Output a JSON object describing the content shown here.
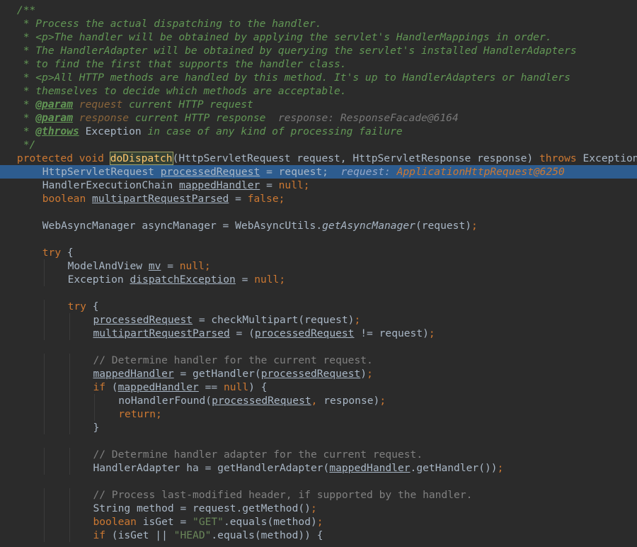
{
  "editor": {
    "lines": [
      {
        "indent": 2,
        "current": false,
        "tokens": [
          {
            "t": "/**",
            "c": "doc"
          }
        ]
      },
      {
        "indent": 2,
        "current": false,
        "tokens": [
          {
            "t": " * Process the actual dispatching to the handler.",
            "c": "doc"
          }
        ]
      },
      {
        "indent": 2,
        "current": false,
        "tokens": [
          {
            "t": " * <p>The handler will be obtained by applying the servlet's HandlerMappings in order.",
            "c": "doc"
          }
        ]
      },
      {
        "indent": 2,
        "current": false,
        "tokens": [
          {
            "t": " * The HandlerAdapter will be obtained by querying the servlet's installed HandlerAdapters",
            "c": "doc"
          }
        ]
      },
      {
        "indent": 2,
        "current": false,
        "tokens": [
          {
            "t": " * to find the first that supports the handler class.",
            "c": "doc"
          }
        ]
      },
      {
        "indent": 2,
        "current": false,
        "tokens": [
          {
            "t": " * <p>All HTTP methods are handled by this method. It's up to HandlerAdapters or handlers",
            "c": "doc"
          }
        ]
      },
      {
        "indent": 2,
        "current": false,
        "tokens": [
          {
            "t": " * themselves to decide which methods are acceptable.",
            "c": "doc"
          }
        ]
      },
      {
        "indent": 2,
        "current": false,
        "tokens": [
          {
            "t": " * ",
            "c": "doc"
          },
          {
            "t": "@param",
            "c": "doctag"
          },
          {
            "t": " ",
            "c": "doc"
          },
          {
            "t": "request",
            "c": "docparam"
          },
          {
            "t": " current HTTP request",
            "c": "doc"
          }
        ]
      },
      {
        "indent": 2,
        "current": false,
        "tokens": [
          {
            "t": " * ",
            "c": "doc"
          },
          {
            "t": "@param",
            "c": "doctag"
          },
          {
            "t": " ",
            "c": "doc"
          },
          {
            "t": "response",
            "c": "docparam"
          },
          {
            "t": " current HTTP response",
            "c": "doc"
          },
          {
            "t": "  ",
            "c": "plain"
          },
          {
            "t": "response: ResponseFacade@6164",
            "c": "hint"
          }
        ]
      },
      {
        "indent": 2,
        "current": false,
        "tokens": [
          {
            "t": " * ",
            "c": "doc"
          },
          {
            "t": "@throws",
            "c": "doctag"
          },
          {
            "t": " ",
            "c": "doc"
          },
          {
            "t": "Exception",
            "c": "plain"
          },
          {
            "t": " in case of any kind of processing failure",
            "c": "doc"
          }
        ]
      },
      {
        "indent": 2,
        "current": false,
        "tokens": [
          {
            "t": " */",
            "c": "doc"
          }
        ]
      },
      {
        "indent": 2,
        "current": false,
        "tokens": [
          {
            "t": "protected void ",
            "c": "kw"
          },
          {
            "t": "doDispatch",
            "c": "fn-hl"
          },
          {
            "t": "(HttpServletRequest request, HttpServletResponse response) ",
            "c": "plain"
          },
          {
            "t": "throws ",
            "c": "kw"
          },
          {
            "t": "Exception {",
            "c": "plain"
          }
        ]
      },
      {
        "indent": 6,
        "current": true,
        "tokens": [
          {
            "t": "HttpServletRequest ",
            "c": "plain"
          },
          {
            "t": "processedRequest",
            "c": "var"
          },
          {
            "t": " = request;",
            "c": "plain"
          },
          {
            "t": "  ",
            "c": "plain"
          },
          {
            "t": "request: ",
            "c": "hint"
          },
          {
            "t": "ApplicationHttpRequest@6250",
            "c": "hint-val"
          }
        ]
      },
      {
        "indent": 6,
        "current": false,
        "tokens": [
          {
            "t": "HandlerExecutionChain ",
            "c": "plain"
          },
          {
            "t": "mappedHandler",
            "c": "var"
          },
          {
            "t": " = ",
            "c": "plain"
          },
          {
            "t": "null",
            "c": "kw"
          },
          {
            "t": ";",
            "c": "kw"
          }
        ]
      },
      {
        "indent": 6,
        "current": false,
        "tokens": [
          {
            "t": "boolean ",
            "c": "kw"
          },
          {
            "t": "multipartRequestParsed",
            "c": "var"
          },
          {
            "t": " = ",
            "c": "plain"
          },
          {
            "t": "false",
            "c": "kw"
          },
          {
            "t": ";",
            "c": "kw"
          }
        ]
      },
      {
        "indent": 0,
        "current": false,
        "tokens": []
      },
      {
        "indent": 6,
        "current": false,
        "tokens": [
          {
            "t": "WebAsyncManager asyncManager = WebAsyncUtils.",
            "c": "plain"
          },
          {
            "t": "getAsyncManager",
            "c": "static"
          },
          {
            "t": "(request)",
            "c": "plain"
          },
          {
            "t": ";",
            "c": "kw"
          }
        ]
      },
      {
        "indent": 0,
        "current": false,
        "tokens": []
      },
      {
        "indent": 6,
        "current": false,
        "tokens": [
          {
            "t": "try ",
            "c": "kw"
          },
          {
            "t": "{",
            "c": "plain"
          }
        ]
      },
      {
        "indent": 10,
        "current": false,
        "tokens": [
          {
            "t": "ModelAndView ",
            "c": "plain"
          },
          {
            "t": "mv",
            "c": "var"
          },
          {
            "t": " = ",
            "c": "plain"
          },
          {
            "t": "null",
            "c": "kw"
          },
          {
            "t": ";",
            "c": "kw"
          }
        ]
      },
      {
        "indent": 10,
        "current": false,
        "tokens": [
          {
            "t": "Exception ",
            "c": "plain"
          },
          {
            "t": "dispatchException",
            "c": "var"
          },
          {
            "t": " = ",
            "c": "plain"
          },
          {
            "t": "null",
            "c": "kw"
          },
          {
            "t": ";",
            "c": "kw"
          }
        ]
      },
      {
        "indent": 0,
        "current": false,
        "tokens": []
      },
      {
        "indent": 10,
        "current": false,
        "tokens": [
          {
            "t": "try ",
            "c": "kw"
          },
          {
            "t": "{",
            "c": "plain"
          }
        ]
      },
      {
        "indent": 14,
        "current": false,
        "tokens": [
          {
            "t": "processedRequest",
            "c": "var"
          },
          {
            "t": " = checkMultipart(request)",
            "c": "plain"
          },
          {
            "t": ";",
            "c": "kw"
          }
        ]
      },
      {
        "indent": 14,
        "current": false,
        "tokens": [
          {
            "t": "multipartRequestParsed",
            "c": "var"
          },
          {
            "t": " = (",
            "c": "plain"
          },
          {
            "t": "processedRequest",
            "c": "var"
          },
          {
            "t": " != request)",
            "c": "plain"
          },
          {
            "t": ";",
            "c": "kw"
          }
        ]
      },
      {
        "indent": 0,
        "current": false,
        "tokens": []
      },
      {
        "indent": 14,
        "current": false,
        "tokens": [
          {
            "t": "// Determine handler for the current request.",
            "c": "comment"
          }
        ]
      },
      {
        "indent": 14,
        "current": false,
        "tokens": [
          {
            "t": "mappedHandler",
            "c": "var"
          },
          {
            "t": " = getHandler(",
            "c": "plain"
          },
          {
            "t": "processedRequest",
            "c": "var"
          },
          {
            "t": ")",
            "c": "plain"
          },
          {
            "t": ";",
            "c": "kw"
          }
        ]
      },
      {
        "indent": 14,
        "current": false,
        "tokens": [
          {
            "t": "if ",
            "c": "kw"
          },
          {
            "t": "(",
            "c": "plain"
          },
          {
            "t": "mappedHandler",
            "c": "var"
          },
          {
            "t": " == ",
            "c": "plain"
          },
          {
            "t": "null",
            "c": "kw"
          },
          {
            "t": ") {",
            "c": "plain"
          }
        ]
      },
      {
        "indent": 18,
        "current": false,
        "tokens": [
          {
            "t": "noHandlerFound(",
            "c": "plain"
          },
          {
            "t": "processedRequest",
            "c": "var"
          },
          {
            "t": ", ",
            "c": "kw"
          },
          {
            "t": "response)",
            "c": "plain"
          },
          {
            "t": ";",
            "c": "kw"
          }
        ]
      },
      {
        "indent": 18,
        "current": false,
        "tokens": [
          {
            "t": "return;",
            "c": "kw"
          }
        ]
      },
      {
        "indent": 14,
        "current": false,
        "tokens": [
          {
            "t": "}",
            "c": "plain"
          }
        ]
      },
      {
        "indent": 0,
        "current": false,
        "tokens": []
      },
      {
        "indent": 14,
        "current": false,
        "tokens": [
          {
            "t": "// Determine handler adapter for the current request.",
            "c": "comment"
          }
        ]
      },
      {
        "indent": 14,
        "current": false,
        "tokens": [
          {
            "t": "HandlerAdapter ha = getHandlerAdapter(",
            "c": "plain"
          },
          {
            "t": "mappedHandler",
            "c": "var"
          },
          {
            "t": ".getHandler())",
            "c": "plain"
          },
          {
            "t": ";",
            "c": "kw"
          }
        ]
      },
      {
        "indent": 0,
        "current": false,
        "tokens": []
      },
      {
        "indent": 14,
        "current": false,
        "tokens": [
          {
            "t": "// Process last-modified header, if supported by the handler.",
            "c": "comment"
          }
        ]
      },
      {
        "indent": 14,
        "current": false,
        "tokens": [
          {
            "t": "String method = request.getMethod()",
            "c": "plain"
          },
          {
            "t": ";",
            "c": "kw"
          }
        ]
      },
      {
        "indent": 14,
        "current": false,
        "tokens": [
          {
            "t": "boolean ",
            "c": "kw"
          },
          {
            "t": "isGet = ",
            "c": "plain"
          },
          {
            "t": "\"GET\"",
            "c": "str"
          },
          {
            "t": ".equals(method)",
            "c": "plain"
          },
          {
            "t": ";",
            "c": "kw"
          }
        ]
      },
      {
        "indent": 14,
        "current": false,
        "tokens": [
          {
            "t": "if ",
            "c": "kw"
          },
          {
            "t": "(isGet || ",
            "c": "plain"
          },
          {
            "t": "\"HEAD\"",
            "c": "str"
          },
          {
            "t": ".equals(method)) {",
            "c": "plain"
          }
        ]
      }
    ]
  }
}
